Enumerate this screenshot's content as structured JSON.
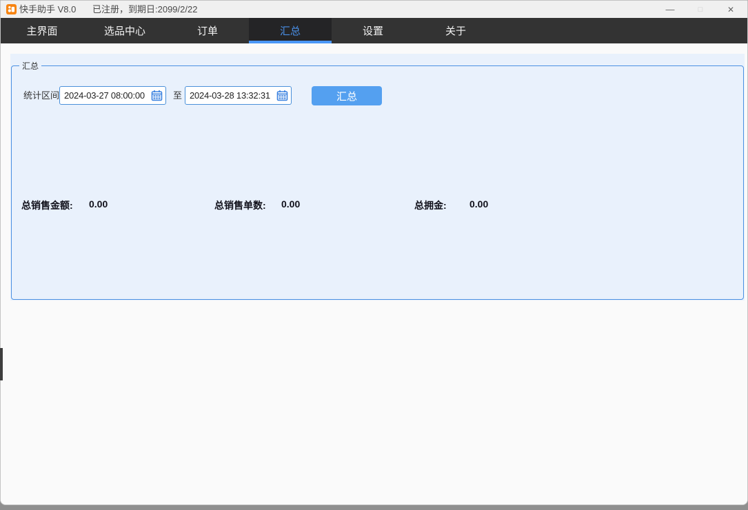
{
  "window": {
    "app_title": "快手助手 V8.0",
    "registration_status": "已注册，到期日:2099/2/22",
    "controls": {
      "minimize": "—",
      "maximize": "□",
      "close": "✕"
    }
  },
  "tabs": [
    {
      "label": "主界面",
      "active": false
    },
    {
      "label": "选品中心",
      "active": false
    },
    {
      "label": "订单",
      "active": false
    },
    {
      "label": "汇总",
      "active": true
    },
    {
      "label": "设置",
      "active": false
    },
    {
      "label": "关于",
      "active": false
    }
  ],
  "summary_panel": {
    "legend": "汇总",
    "range_label": "统计区间:",
    "start_datetime": "2024-03-27 08:00:00",
    "to_label": "至",
    "end_datetime": "2024-03-28 13:32:31",
    "summarize_button": "汇总",
    "totals": [
      {
        "label": "总销售金额:",
        "value": "0.00"
      },
      {
        "label": "总销售单数:",
        "value": "0.00"
      },
      {
        "label": "总拥金:",
        "value": "0.00"
      }
    ]
  },
  "colors": {
    "accent_blue": "#4a90e2",
    "button_blue": "#54a0f0",
    "panel_fill": "#e9f1fc",
    "tabbar_bg": "#333333",
    "active_tab_bg": "#242426",
    "tab_underline": "#4a97f7",
    "app_icon_orange": "#f78412"
  }
}
